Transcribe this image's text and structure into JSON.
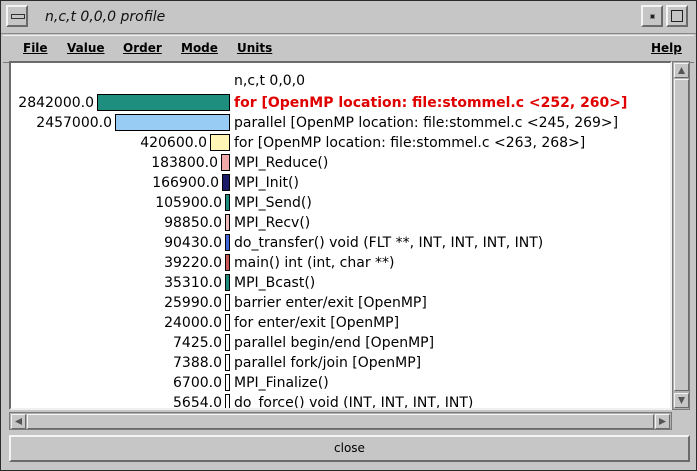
{
  "window": {
    "title": "n,c,t 0,0,0 profile"
  },
  "menu": {
    "file": "File",
    "value": "Value",
    "order": "Order",
    "mode": "Mode",
    "units": "Units",
    "help": "Help"
  },
  "profile": {
    "header": "n,c,t 0,0,0",
    "rows": [
      {
        "value": "2842000.0",
        "amount": 2842000.0,
        "color": "#1e8f7e",
        "label": "for  [OpenMP location: file:stommel.c <252, 260>]",
        "highlight": true
      },
      {
        "value": "2457000.0",
        "amount": 2457000.0,
        "color": "#99ccf5",
        "label": "parallel  [OpenMP location: file:stommel.c <245, 269>]",
        "highlight": false
      },
      {
        "value": "420600.0",
        "amount": 420600.0,
        "color": "#fff5b5",
        "label": "for  [OpenMP location: file:stommel.c <263, 268>]",
        "highlight": false
      },
      {
        "value": "183800.0",
        "amount": 183800.0,
        "color": "#f0a8a8",
        "label": "MPI_Reduce()",
        "highlight": false
      },
      {
        "value": "166900.0",
        "amount": 166900.0,
        "color": "#1a1a66",
        "label": "MPI_Init()",
        "highlight": false
      },
      {
        "value": "105900.0",
        "amount": 105900.0,
        "color": "#1e8f7e",
        "label": "MPI_Send()",
        "highlight": false
      },
      {
        "value": "98850.0",
        "amount": 98850.0,
        "color": "#f0b8b8",
        "label": "MPI_Recv()",
        "highlight": false
      },
      {
        "value": "90430.0",
        "amount": 90430.0,
        "color": "#4466dd",
        "label": "do_transfer() void (FLT **, INT, INT, INT, INT)",
        "highlight": false
      },
      {
        "value": "39220.0",
        "amount": 39220.0,
        "color": "#cc5555",
        "label": "main() int (int, char **)",
        "highlight": false
      },
      {
        "value": "35310.0",
        "amount": 35310.0,
        "color": "#1e8f7e",
        "label": "MPI_Bcast()",
        "highlight": false
      },
      {
        "value": "25990.0",
        "amount": 25990.0,
        "color": "#ffffff",
        "label": "barrier enter/exit [OpenMP]",
        "highlight": false
      },
      {
        "value": "24000.0",
        "amount": 24000.0,
        "color": "#ffffff",
        "label": "for enter/exit [OpenMP]",
        "highlight": false
      },
      {
        "value": "7425.0",
        "amount": 7425.0,
        "color": "#ffffff",
        "label": "parallel begin/end [OpenMP]",
        "highlight": false
      },
      {
        "value": "7388.0",
        "amount": 7388.0,
        "color": "#ffffff",
        "label": "parallel fork/join [OpenMP]",
        "highlight": false
      },
      {
        "value": "6700.0",
        "amount": 6700.0,
        "color": "#ffffff",
        "label": "MPI_Finalize()",
        "highlight": false
      },
      {
        "value": "5654.0",
        "amount": 5654.0,
        "color": "#ffffff",
        "label": "do_force() void (INT, INT, INT, INT)",
        "highlight": false
      }
    ]
  },
  "footer": {
    "close": "close"
  }
}
